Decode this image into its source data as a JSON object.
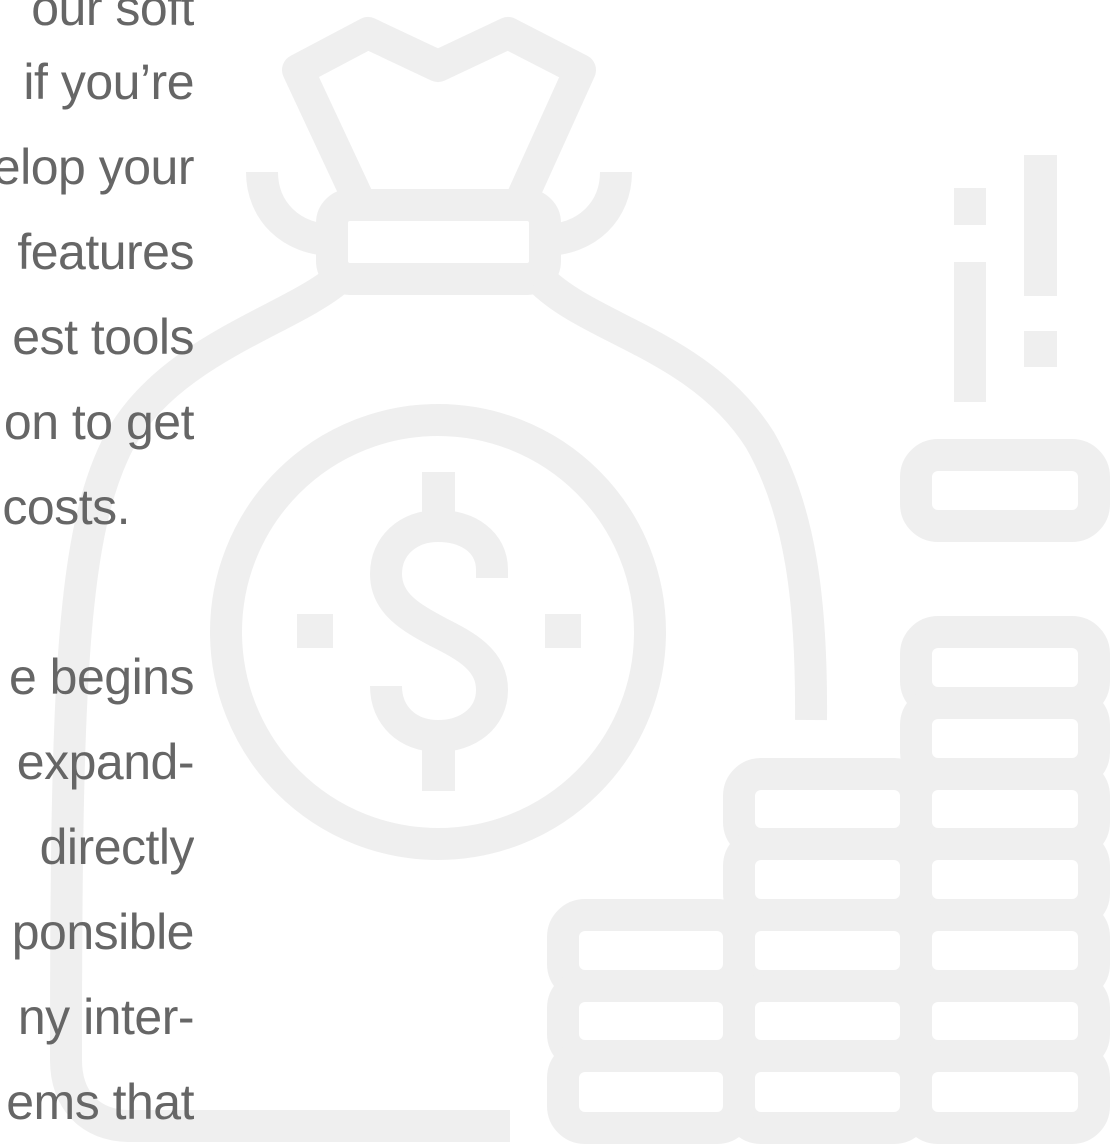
{
  "colors": {
    "text": "#666666",
    "illustration": "#efefef",
    "background": "#ffffff"
  },
  "text_lines": [
    "our soft",
    "if you’re",
    "elop your",
    "features",
    "est tools",
    "on to get",
    "costs.",
    "e begins",
    "expand-",
    "directly",
    "ponsible",
    "ny inter-",
    "ems that"
  ],
  "icons": {
    "background": "money-bag-with-coin-stacks-icon"
  }
}
